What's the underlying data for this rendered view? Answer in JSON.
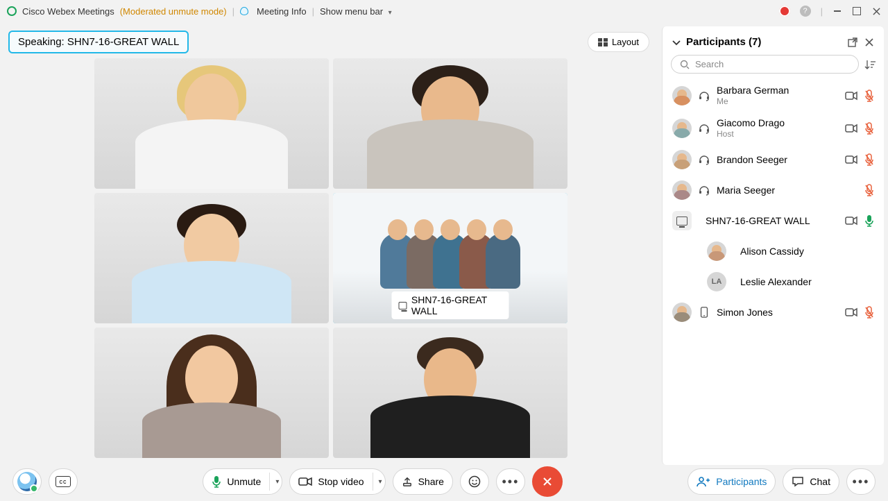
{
  "header": {
    "app_name": "Cisco Webex Meetings",
    "mode": "(Moderated unmute mode)",
    "meeting_info": "Meeting Info",
    "show_menu": "Show menu bar"
  },
  "speaking": {
    "prefix": "Speaking: ",
    "name": "SHN7-16-GREAT WALL"
  },
  "layout_label": "Layout",
  "active_tile": {
    "label": "SHN7-16-GREAT WALL"
  },
  "panel": {
    "title": "Participants (7)",
    "search_placeholder": "Search",
    "participants": [
      {
        "name": "Barbara German",
        "sub": "Me",
        "headset": true,
        "video": true,
        "mic_muted": true
      },
      {
        "name": "Giacomo Drago",
        "sub": "Host",
        "headset": true,
        "video": true,
        "mic_muted": true
      },
      {
        "name": "Brandon Seeger",
        "sub": "",
        "headset": true,
        "video": true,
        "mic_muted": true
      },
      {
        "name": "Maria Seeger",
        "sub": "",
        "headset": true,
        "video": false,
        "mic_muted": true
      },
      {
        "name": "SHN7-16-GREAT WALL",
        "sub": "",
        "device": true,
        "video": true,
        "mic_muted": false
      },
      {
        "name": "Alison Cassidy",
        "sub": "",
        "sublevel": true
      },
      {
        "name": "Leslie Alexander",
        "sub": "",
        "sublevel": true,
        "initials": "LA"
      },
      {
        "name": "Simon Jones",
        "sub": "",
        "mobile": true,
        "video": true,
        "mic_muted": true
      }
    ]
  },
  "toolbar": {
    "unmute": "Unmute",
    "stop_video": "Stop video",
    "share": "Share",
    "participants": "Participants",
    "chat": "Chat"
  }
}
